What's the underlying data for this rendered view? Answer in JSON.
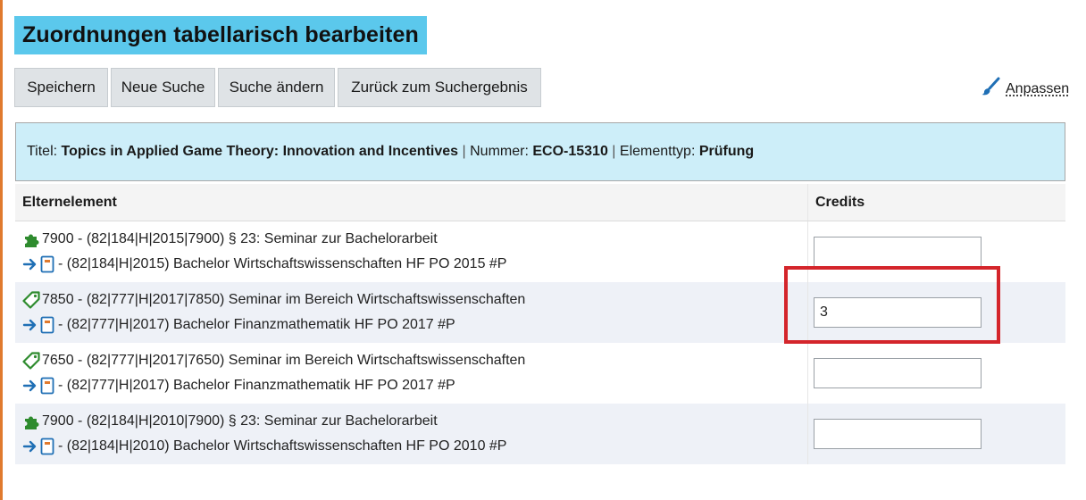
{
  "page": {
    "title": "Zuordnungen tabellarisch bearbeiten"
  },
  "toolbar": {
    "save_label": "Speichern",
    "new_search_label": "Neue Suche",
    "change_search_label": "Suche ändern",
    "back_label": "Zurück zum Suchergebnis",
    "customize_label": "Anpassen"
  },
  "info": {
    "title_label": "Titel:",
    "title_value": "Topics in Applied Game Theory: Innovation and Incentives",
    "sep1": "|",
    "number_label": "Nummer:",
    "number_value": "ECO-15310",
    "sep2": "|",
    "type_label": "Elementtyp:",
    "type_value": "Prüfung"
  },
  "table": {
    "columns": [
      "Elternelement",
      "Credits"
    ],
    "rows": [
      {
        "icon": "puzzle-icon",
        "primary": "7900 - (82|184|H|2015|7900) § 23: Seminar zur Bachelorarbeit",
        "secondary": "- (82|184|H|2015) Bachelor Wirtschaftswissenschaften HF PO 2015 #P",
        "credits": ""
      },
      {
        "icon": "tag-icon",
        "primary": "7850 - (82|777|H|2017|7850) Seminar im Bereich Wirtschaftswissenschaften",
        "secondary": "- (82|777|H|2017) Bachelor Finanzmathematik HF PO 2017 #P",
        "credits": "3"
      },
      {
        "icon": "tag-icon",
        "primary": "7650 - (82|777|H|2017|7650) Seminar im Bereich Wirtschaftswissenschaften",
        "secondary": "- (82|777|H|2017) Bachelor Finanzmathematik HF PO 2017 #P",
        "credits": ""
      },
      {
        "icon": "puzzle-icon",
        "primary": "7900 - (82|184|H|2010|7900) § 23: Seminar zur Bachelorarbeit",
        "secondary": "- (82|184|H|2010) Bachelor Wirtschaftswissenschaften HF PO 2010 #P",
        "credits": ""
      }
    ]
  },
  "colors": {
    "title_bg": "#5bc8ec",
    "info_bg": "#cdeef9",
    "highlight": "#d4252b",
    "icon_green": "#2e8b2e",
    "icon_blue": "#1f6fb5",
    "icon_orange": "#e07a2e"
  }
}
